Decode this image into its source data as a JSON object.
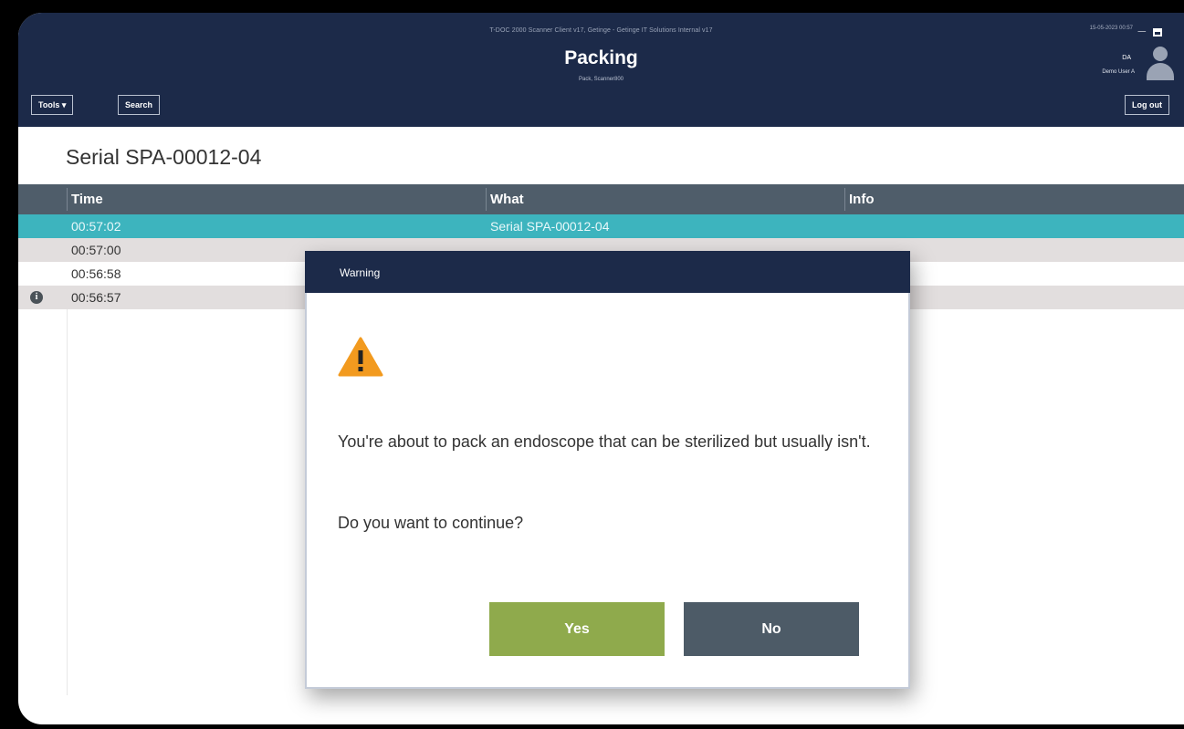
{
  "window": {
    "app_title": "T-DOC 2000 Scanner Client v17, Getinge - Getinge IT Solutions Internal v17",
    "datetime": "15-05-2023 00:57"
  },
  "header": {
    "title": "Packing",
    "subtitle": "Pack, Scanner800",
    "user_initials": "DA",
    "user_name": "Demo User A"
  },
  "toolbar": {
    "tools_label": "Tools ▾",
    "search_label": "Search",
    "logout_label": "Log out"
  },
  "main": {
    "heading": "Serial SPA-00012-04",
    "table": {
      "columns": [
        "Time",
        "What",
        "Info"
      ],
      "rows": [
        {
          "time": "00:57:02",
          "what": "Serial SPA-00012-04",
          "info": ""
        },
        {
          "time": "00:57:00",
          "what": "",
          "info": ""
        },
        {
          "time": "00:56:58",
          "what": "",
          "info": ""
        },
        {
          "time": "00:56:57",
          "what": "",
          "info": ""
        }
      ]
    }
  },
  "dialog": {
    "title": "Warning",
    "message": "You're about to pack an endoscope that can be sterilized but usually isn't.",
    "question": "Do you want to continue?",
    "yes_label": "Yes",
    "no_label": "No"
  },
  "colors": {
    "header_bg": "#1c2a49",
    "selected_row": "#3db4be",
    "alt_row": "#e2dede",
    "table_header": "#4f5d6a",
    "yes_button": "#8faa4c",
    "no_button": "#4d5b67",
    "warning_icon": "#f29a1f"
  },
  "icons": [
    "user-avatar-icon",
    "info-icon",
    "warning-icon",
    "minimize-icon",
    "maximize-icon"
  ]
}
